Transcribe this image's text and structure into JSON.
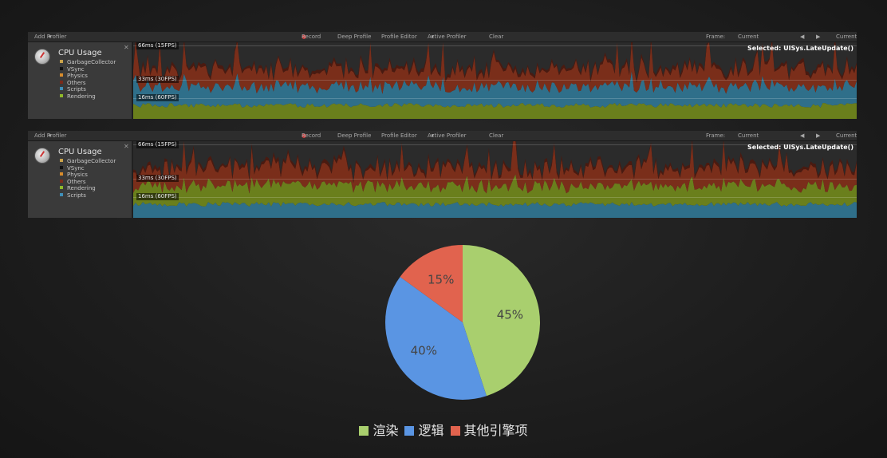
{
  "profilers": [
    {
      "toolbar": {
        "add_profiler": "Add Profiler",
        "record": "Record",
        "deep_profile": "Deep Profile",
        "profile_editor": "Profile Editor",
        "active_profiler": "Active Profiler",
        "clear": "Clear",
        "frame_label": "Frame:",
        "frame_value": "Current",
        "current_btn": "Current"
      },
      "title": "CPU Usage",
      "legend": [
        {
          "label": "GarbageCollector",
          "color": "#c9a24a"
        },
        {
          "label": "VSync",
          "color": "#111111"
        },
        {
          "label": "Physics",
          "color": "#d88c2c"
        },
        {
          "label": "Others",
          "color": "#7a2a1a"
        },
        {
          "label": "Scripts",
          "color": "#3f8fb8"
        },
        {
          "label": "Rendering",
          "color": "#8fb82a"
        }
      ],
      "ref_lines": [
        "66ms (15FPS)",
        "33ms (30FPS)",
        "16ms (60FPS)"
      ],
      "selected": "Selected: UISys.LateUpdate()"
    },
    {
      "toolbar": {
        "add_profiler": "Add Profiler",
        "record": "Record",
        "deep_profile": "Deep Profile",
        "profile_editor": "Profile Editor",
        "active_profiler": "Active Profiler",
        "clear": "Clear",
        "frame_label": "Frame:",
        "frame_value": "Current",
        "current_btn": "Current"
      },
      "title": "CPU Usage",
      "legend": [
        {
          "label": "GarbageCollector",
          "color": "#c9a24a"
        },
        {
          "label": "VSync",
          "color": "#111111"
        },
        {
          "label": "Physics",
          "color": "#d88c2c"
        },
        {
          "label": "Others",
          "color": "#7a2a1a"
        },
        {
          "label": "Rendering",
          "color": "#8fb82a"
        },
        {
          "label": "Scripts",
          "color": "#3f8fb8"
        }
      ],
      "ref_lines": [
        "66ms (15FPS)",
        "33ms (30FPS)",
        "16ms (60FPS)"
      ],
      "selected": "Selected: UISys.LateUpdate()"
    }
  ],
  "chart_data": {
    "type": "pie",
    "slices": [
      {
        "name": "渲染",
        "value": 45,
        "label": "45%",
        "color": "#a9cf6e"
      },
      {
        "name": "逻辑",
        "value": 40,
        "label": "40%",
        "color": "#5a95e3"
      },
      {
        "name": "其他引擎项",
        "value": 15,
        "label": "15%",
        "color": "#e1634e"
      }
    ],
    "legend_position": "bottom"
  }
}
